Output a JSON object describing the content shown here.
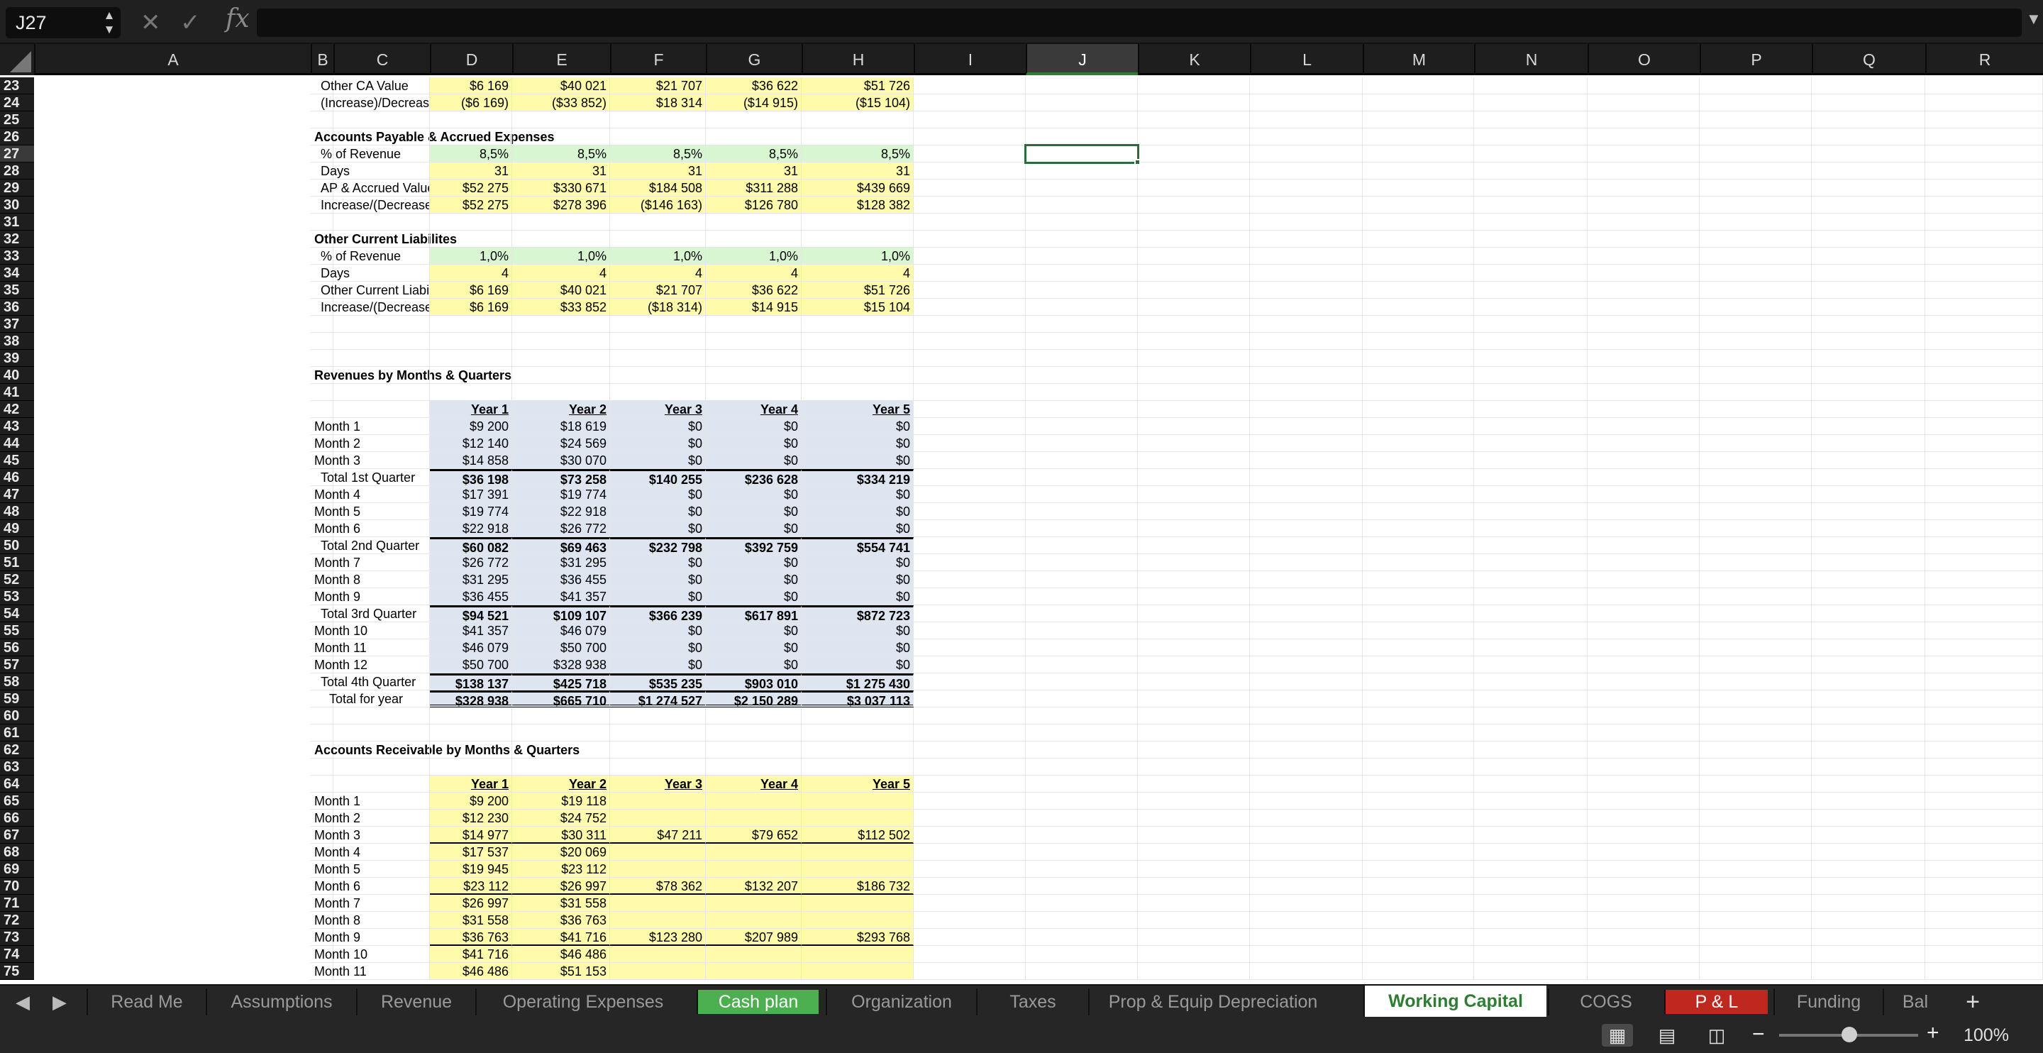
{
  "formula_bar": {
    "name_box": "J27",
    "cancel_icon": "cancel-icon",
    "confirm_icon": "check-icon",
    "fx_label": "fx",
    "formula": ""
  },
  "columns": [
    "A",
    "B",
    "C",
    "D",
    "E",
    "F",
    "G",
    "H",
    "I",
    "J",
    "K",
    "L",
    "M",
    "N",
    "O",
    "P",
    "Q",
    "R"
  ],
  "selected_column": "J",
  "selected_cell": "J27",
  "rows": [
    {
      "n": "23",
      "label": "Other CA Value",
      "indent": true,
      "vals": [
        "$6 169",
        "$40 021",
        "$21 707",
        "$36 622",
        "$51 726"
      ],
      "fill": "y"
    },
    {
      "n": "24",
      "label": "(Increase)/Decrease from Prev. Period",
      "indent": true,
      "vals": [
        "($6 169)",
        "($33 852)",
        "$18 314",
        "($14 915)",
        "($15 104)"
      ],
      "fill": "y"
    },
    {
      "n": "25",
      "label": ""
    },
    {
      "n": "26",
      "label": "Accounts Payable & Accrued Expenses",
      "bold": true
    },
    {
      "n": "27",
      "label": "% of Revenue",
      "indent": true,
      "vals": [
        "8,5%",
        "8,5%",
        "8,5%",
        "8,5%",
        "8,5%"
      ],
      "fill": "g"
    },
    {
      "n": "28",
      "label": "Days",
      "indent": true,
      "vals": [
        "31",
        "31",
        "31",
        "31",
        "31"
      ],
      "fill": "y"
    },
    {
      "n": "29",
      "label": "AP & Accrued Value",
      "indent": true,
      "vals": [
        "$52 275",
        "$330 671",
        "$184 508",
        "$311 288",
        "$439 669"
      ],
      "fill": "y"
    },
    {
      "n": "30",
      "label": "Increase/(Decrease) from Prev. Period",
      "indent": true,
      "vals": [
        "$52 275",
        "$278 396",
        "($146 163)",
        "$126 780",
        "$128 382"
      ],
      "fill": "y"
    },
    {
      "n": "31",
      "label": ""
    },
    {
      "n": "32",
      "label": "Other Current Liabilites",
      "bold": true
    },
    {
      "n": "33",
      "label": "% of Revenue",
      "indent": true,
      "vals": [
        "1,0%",
        "1,0%",
        "1,0%",
        "1,0%",
        "1,0%"
      ],
      "fill": "g"
    },
    {
      "n": "34",
      "label": "Days",
      "indent": true,
      "vals": [
        "4",
        "4",
        "4",
        "4",
        "4"
      ],
      "fill": "y"
    },
    {
      "n": "35",
      "label": "Other Current Liabilities",
      "indent": true,
      "vals": [
        "$6 169",
        "$40 021",
        "$21 707",
        "$36 622",
        "$51 726"
      ],
      "fill": "y"
    },
    {
      "n": "36",
      "label": "Increase/(Decrease) from Prev. Period",
      "indent": true,
      "vals": [
        "$6 169",
        "$33 852",
        "($18 314)",
        "$14 915",
        "$15 104"
      ],
      "fill": "y"
    },
    {
      "n": "37",
      "label": ""
    },
    {
      "n": "38",
      "label": ""
    },
    {
      "n": "39",
      "label": ""
    },
    {
      "n": "40",
      "label": "Revenues by Months & Quarters",
      "bold": true
    },
    {
      "n": "41",
      "label": ""
    },
    {
      "n": "42",
      "label": "",
      "vals": [
        "Year 1",
        "Year 2",
        "Year 3",
        "Year 4",
        "Year 5"
      ],
      "fill": "b",
      "header": true
    },
    {
      "n": "43",
      "label": "Month 1",
      "vals": [
        "$9 200",
        "$18 619",
        "$0",
        "$0",
        "$0"
      ],
      "fill": "b"
    },
    {
      "n": "44",
      "label": "Month 2",
      "vals": [
        "$12 140",
        "$24 569",
        "$0",
        "$0",
        "$0"
      ],
      "fill": "b"
    },
    {
      "n": "45",
      "label": "Month 3",
      "vals": [
        "$14 858",
        "$30 070",
        "$0",
        "$0",
        "$0"
      ],
      "fill": "b"
    },
    {
      "n": "46",
      "label": "Total 1st Quarter",
      "indent": true,
      "vals": [
        "$36 198",
        "$73 258",
        "$140 255",
        "$236 628",
        "$334 219"
      ],
      "fill": "b",
      "total": true
    },
    {
      "n": "47",
      "label": "Month 4",
      "vals": [
        "$17 391",
        "$19 774",
        "$0",
        "$0",
        "$0"
      ],
      "fill": "b"
    },
    {
      "n": "48",
      "label": "Month 5",
      "vals": [
        "$19 774",
        "$22 918",
        "$0",
        "$0",
        "$0"
      ],
      "fill": "b"
    },
    {
      "n": "49",
      "label": "Month 6",
      "vals": [
        "$22 918",
        "$26 772",
        "$0",
        "$0",
        "$0"
      ],
      "fill": "b"
    },
    {
      "n": "50",
      "label": "Total 2nd Quarter",
      "indent": true,
      "vals": [
        "$60 082",
        "$69 463",
        "$232 798",
        "$392 759",
        "$554 741"
      ],
      "fill": "b",
      "total": true
    },
    {
      "n": "51",
      "label": "Month 7",
      "vals": [
        "$26 772",
        "$31 295",
        "$0",
        "$0",
        "$0"
      ],
      "fill": "b"
    },
    {
      "n": "52",
      "label": "Month 8",
      "vals": [
        "$31 295",
        "$36 455",
        "$0",
        "$0",
        "$0"
      ],
      "fill": "b"
    },
    {
      "n": "53",
      "label": "Month 9",
      "vals": [
        "$36 455",
        "$41 357",
        "$0",
        "$0",
        "$0"
      ],
      "fill": "b"
    },
    {
      "n": "54",
      "label": "Total 3rd Quarter",
      "indent": true,
      "vals": [
        "$94 521",
        "$109 107",
        "$366 239",
        "$617 891",
        "$872 723"
      ],
      "fill": "b",
      "total": true
    },
    {
      "n": "55",
      "label": "Month 10",
      "vals": [
        "$41 357",
        "$46 079",
        "$0",
        "$0",
        "$0"
      ],
      "fill": "b"
    },
    {
      "n": "56",
      "label": "Month 11",
      "vals": [
        "$46 079",
        "$50 700",
        "$0",
        "$0",
        "$0"
      ],
      "fill": "b"
    },
    {
      "n": "57",
      "label": "Month 12",
      "vals": [
        "$50 700",
        "$328 938",
        "$0",
        "$0",
        "$0"
      ],
      "fill": "b"
    },
    {
      "n": "58",
      "label": "Total 4th Quarter",
      "indent": true,
      "vals": [
        "$138 137",
        "$425 718",
        "$535 235",
        "$903 010",
        "$1 275 430"
      ],
      "fill": "b",
      "total": true
    },
    {
      "n": "59",
      "label": "Total for year",
      "indent2": true,
      "vals": [
        "$328 938",
        "$665 710",
        "$1 274 527",
        "$2 150 289",
        "$3 037 113"
      ],
      "fill": "b",
      "grand": true
    },
    {
      "n": "60",
      "label": ""
    },
    {
      "n": "61",
      "label": ""
    },
    {
      "n": "62",
      "label": "Accounts Receivable by Months & Quarters",
      "bold": true
    },
    {
      "n": "63",
      "label": ""
    },
    {
      "n": "64",
      "label": "",
      "vals": [
        "Year 1",
        "Year 2",
        "Year 3",
        "Year 4",
        "Year 5"
      ],
      "fill": "y",
      "header": true
    },
    {
      "n": "65",
      "label": "Month 1",
      "vals": [
        "$9 200",
        "$19 118",
        "",
        "",
        ""
      ],
      "fill": "y"
    },
    {
      "n": "66",
      "label": "Month 2",
      "vals": [
        "$12 230",
        "$24 752",
        "",
        "",
        ""
      ],
      "fill": "y"
    },
    {
      "n": "67",
      "label": "Month 3",
      "vals": [
        "$14 977",
        "$30 311",
        "$47 211",
        "$79 652",
        "$112 502"
      ],
      "fill": "y",
      "qline": true
    },
    {
      "n": "68",
      "label": "Month 4",
      "vals": [
        "$17 537",
        "$20 069",
        "",
        "",
        ""
      ],
      "fill": "y"
    },
    {
      "n": "69",
      "label": "Month 5",
      "vals": [
        "$19 945",
        "$23 112",
        "",
        "",
        ""
      ],
      "fill": "y"
    },
    {
      "n": "70",
      "label": "Month 6",
      "vals": [
        "$23 112",
        "$26 997",
        "$78 362",
        "$132 207",
        "$186 732"
      ],
      "fill": "y",
      "qline": true
    },
    {
      "n": "71",
      "label": "Month 7",
      "vals": [
        "$26 997",
        "$31 558",
        "",
        "",
        ""
      ],
      "fill": "y"
    },
    {
      "n": "72",
      "label": "Month 8",
      "vals": [
        "$31 558",
        "$36 763",
        "",
        "",
        ""
      ],
      "fill": "y"
    },
    {
      "n": "73",
      "label": "Month 9",
      "vals": [
        "$36 763",
        "$41 716",
        "$123 280",
        "$207 989",
        "$293 768"
      ],
      "fill": "y",
      "qline": true
    },
    {
      "n": "74",
      "label": "Month 10",
      "vals": [
        "$41 716",
        "$46 486",
        "",
        "",
        ""
      ],
      "fill": "y"
    },
    {
      "n": "75",
      "label": "Month 11",
      "vals": [
        "$46 486",
        "$51 153",
        "",
        "",
        ""
      ],
      "fill": "y"
    }
  ],
  "tabs": [
    {
      "label": "Read Me",
      "style": ""
    },
    {
      "label": "Assumptions",
      "style": ""
    },
    {
      "label": "Revenue",
      "style": ""
    },
    {
      "label": "Operating Expenses",
      "style": ""
    },
    {
      "label": "Cash plan",
      "style": "green"
    },
    {
      "label": "Organization",
      "style": ""
    },
    {
      "label": "Taxes",
      "style": ""
    },
    {
      "label": "Prop & Equip Depreciation",
      "style": ""
    },
    {
      "label": "Working Capital",
      "style": "active"
    },
    {
      "label": "COGS",
      "style": ""
    },
    {
      "label": "P & L",
      "style": "red"
    },
    {
      "label": "Funding",
      "style": ""
    },
    {
      "label": "Bal",
      "style": ""
    }
  ],
  "status": {
    "zoom": "100%",
    "zoom_level": 100
  },
  "colors": {
    "yellow_fill": "#fffbaa",
    "green_fill": "#d8f7d0",
    "blue_fill": "#dde5f0",
    "active_tab_text": "#2e7d32",
    "red_tab": "#c0281f",
    "green_tab": "#4caf50"
  }
}
